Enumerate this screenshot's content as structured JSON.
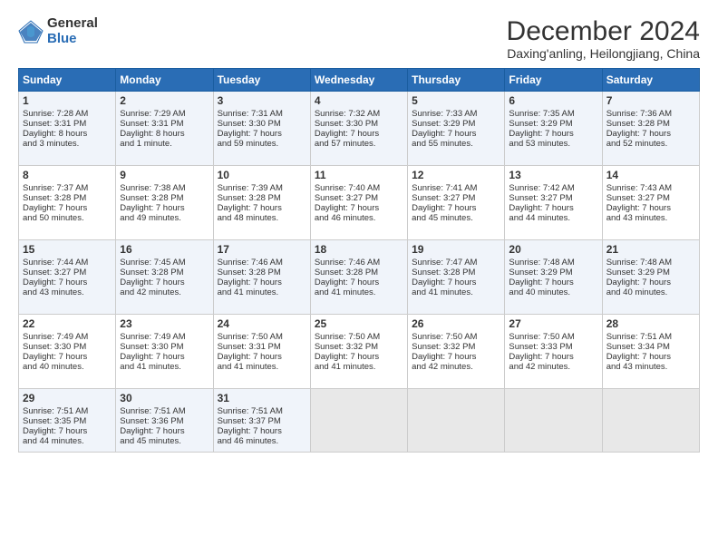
{
  "header": {
    "logo_general": "General",
    "logo_blue": "Blue",
    "month_title": "December 2024",
    "location": "Daxing'anling, Heilongjiang, China"
  },
  "weekdays": [
    "Sunday",
    "Monday",
    "Tuesday",
    "Wednesday",
    "Thursday",
    "Friday",
    "Saturday"
  ],
  "weeks": [
    [
      {
        "day": "1",
        "lines": [
          "Sunrise: 7:28 AM",
          "Sunset: 3:31 PM",
          "Daylight: 8 hours",
          "and 3 minutes."
        ]
      },
      {
        "day": "2",
        "lines": [
          "Sunrise: 7:29 AM",
          "Sunset: 3:31 PM",
          "Daylight: 8 hours",
          "and 1 minute."
        ]
      },
      {
        "day": "3",
        "lines": [
          "Sunrise: 7:31 AM",
          "Sunset: 3:30 PM",
          "Daylight: 7 hours",
          "and 59 minutes."
        ]
      },
      {
        "day": "4",
        "lines": [
          "Sunrise: 7:32 AM",
          "Sunset: 3:30 PM",
          "Daylight: 7 hours",
          "and 57 minutes."
        ]
      },
      {
        "day": "5",
        "lines": [
          "Sunrise: 7:33 AM",
          "Sunset: 3:29 PM",
          "Daylight: 7 hours",
          "and 55 minutes."
        ]
      },
      {
        "day": "6",
        "lines": [
          "Sunrise: 7:35 AM",
          "Sunset: 3:29 PM",
          "Daylight: 7 hours",
          "and 53 minutes."
        ]
      },
      {
        "day": "7",
        "lines": [
          "Sunrise: 7:36 AM",
          "Sunset: 3:28 PM",
          "Daylight: 7 hours",
          "and 52 minutes."
        ]
      }
    ],
    [
      {
        "day": "8",
        "lines": [
          "Sunrise: 7:37 AM",
          "Sunset: 3:28 PM",
          "Daylight: 7 hours",
          "and 50 minutes."
        ]
      },
      {
        "day": "9",
        "lines": [
          "Sunrise: 7:38 AM",
          "Sunset: 3:28 PM",
          "Daylight: 7 hours",
          "and 49 minutes."
        ]
      },
      {
        "day": "10",
        "lines": [
          "Sunrise: 7:39 AM",
          "Sunset: 3:28 PM",
          "Daylight: 7 hours",
          "and 48 minutes."
        ]
      },
      {
        "day": "11",
        "lines": [
          "Sunrise: 7:40 AM",
          "Sunset: 3:27 PM",
          "Daylight: 7 hours",
          "and 46 minutes."
        ]
      },
      {
        "day": "12",
        "lines": [
          "Sunrise: 7:41 AM",
          "Sunset: 3:27 PM",
          "Daylight: 7 hours",
          "and 45 minutes."
        ]
      },
      {
        "day": "13",
        "lines": [
          "Sunrise: 7:42 AM",
          "Sunset: 3:27 PM",
          "Daylight: 7 hours",
          "and 44 minutes."
        ]
      },
      {
        "day": "14",
        "lines": [
          "Sunrise: 7:43 AM",
          "Sunset: 3:27 PM",
          "Daylight: 7 hours",
          "and 43 minutes."
        ]
      }
    ],
    [
      {
        "day": "15",
        "lines": [
          "Sunrise: 7:44 AM",
          "Sunset: 3:27 PM",
          "Daylight: 7 hours",
          "and 43 minutes."
        ]
      },
      {
        "day": "16",
        "lines": [
          "Sunrise: 7:45 AM",
          "Sunset: 3:28 PM",
          "Daylight: 7 hours",
          "and 42 minutes."
        ]
      },
      {
        "day": "17",
        "lines": [
          "Sunrise: 7:46 AM",
          "Sunset: 3:28 PM",
          "Daylight: 7 hours",
          "and 41 minutes."
        ]
      },
      {
        "day": "18",
        "lines": [
          "Sunrise: 7:46 AM",
          "Sunset: 3:28 PM",
          "Daylight: 7 hours",
          "and 41 minutes."
        ]
      },
      {
        "day": "19",
        "lines": [
          "Sunrise: 7:47 AM",
          "Sunset: 3:28 PM",
          "Daylight: 7 hours",
          "and 41 minutes."
        ]
      },
      {
        "day": "20",
        "lines": [
          "Sunrise: 7:48 AM",
          "Sunset: 3:29 PM",
          "Daylight: 7 hours",
          "and 40 minutes."
        ]
      },
      {
        "day": "21",
        "lines": [
          "Sunrise: 7:48 AM",
          "Sunset: 3:29 PM",
          "Daylight: 7 hours",
          "and 40 minutes."
        ]
      }
    ],
    [
      {
        "day": "22",
        "lines": [
          "Sunrise: 7:49 AM",
          "Sunset: 3:30 PM",
          "Daylight: 7 hours",
          "and 40 minutes."
        ]
      },
      {
        "day": "23",
        "lines": [
          "Sunrise: 7:49 AM",
          "Sunset: 3:30 PM",
          "Daylight: 7 hours",
          "and 41 minutes."
        ]
      },
      {
        "day": "24",
        "lines": [
          "Sunrise: 7:50 AM",
          "Sunset: 3:31 PM",
          "Daylight: 7 hours",
          "and 41 minutes."
        ]
      },
      {
        "day": "25",
        "lines": [
          "Sunrise: 7:50 AM",
          "Sunset: 3:32 PM",
          "Daylight: 7 hours",
          "and 41 minutes."
        ]
      },
      {
        "day": "26",
        "lines": [
          "Sunrise: 7:50 AM",
          "Sunset: 3:32 PM",
          "Daylight: 7 hours",
          "and 42 minutes."
        ]
      },
      {
        "day": "27",
        "lines": [
          "Sunrise: 7:50 AM",
          "Sunset: 3:33 PM",
          "Daylight: 7 hours",
          "and 42 minutes."
        ]
      },
      {
        "day": "28",
        "lines": [
          "Sunrise: 7:51 AM",
          "Sunset: 3:34 PM",
          "Daylight: 7 hours",
          "and 43 minutes."
        ]
      }
    ],
    [
      {
        "day": "29",
        "lines": [
          "Sunrise: 7:51 AM",
          "Sunset: 3:35 PM",
          "Daylight: 7 hours",
          "and 44 minutes."
        ]
      },
      {
        "day": "30",
        "lines": [
          "Sunrise: 7:51 AM",
          "Sunset: 3:36 PM",
          "Daylight: 7 hours",
          "and 45 minutes."
        ]
      },
      {
        "day": "31",
        "lines": [
          "Sunrise: 7:51 AM",
          "Sunset: 3:37 PM",
          "Daylight: 7 hours",
          "and 46 minutes."
        ]
      },
      null,
      null,
      null,
      null
    ]
  ]
}
